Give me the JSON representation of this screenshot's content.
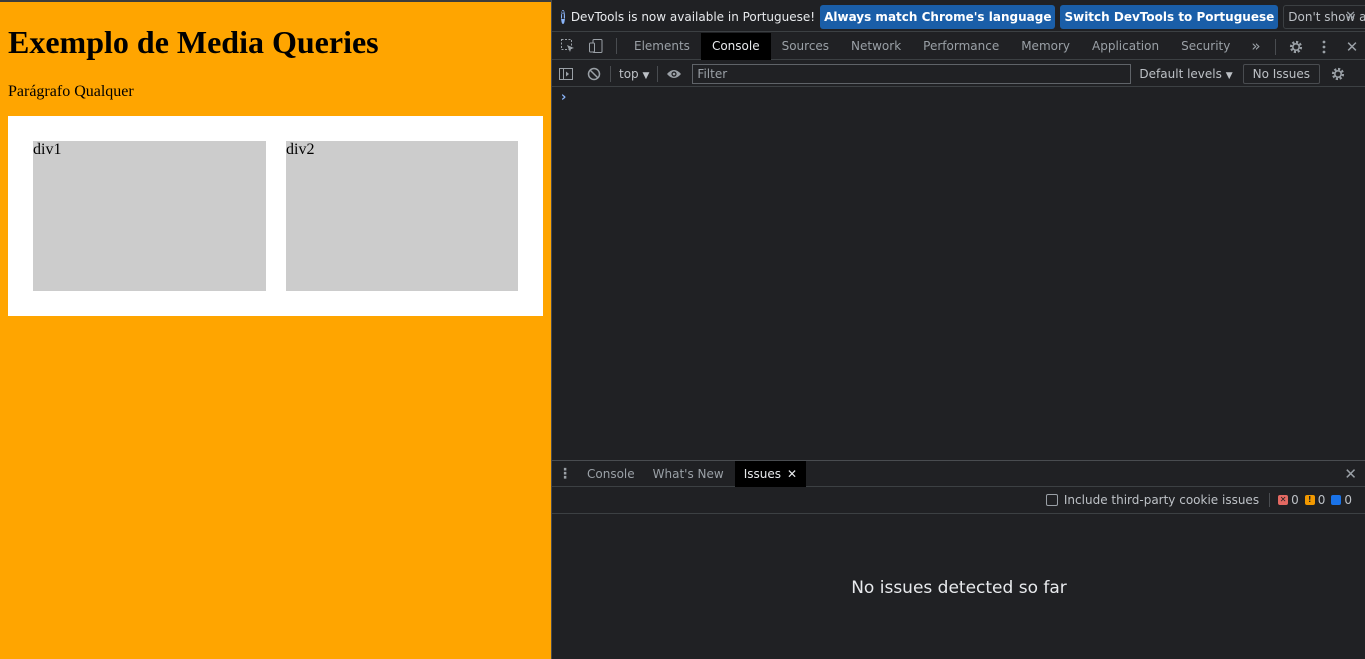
{
  "page": {
    "heading": "Exemplo de Media Queries",
    "paragraph": "Parágrafo Qualquer",
    "boxes": [
      "div1",
      "div2"
    ],
    "colors": {
      "background": "#ffa500",
      "container": "#ffffff",
      "box": "#cccccc"
    }
  },
  "devtools": {
    "infobar": {
      "message": "DevTools is now available in Portuguese!",
      "match_button": "Always match Chrome's language",
      "switch_button": "Switch DevTools to Portuguese",
      "dismiss_button": "Don't show again",
      "icons": {
        "info": "info-icon",
        "close": "close-icon"
      }
    },
    "tabs": [
      "Elements",
      "Console",
      "Sources",
      "Network",
      "Performance",
      "Memory",
      "Application",
      "Security"
    ],
    "active_tab": "Console",
    "toolbar": {
      "context": "top",
      "filter_placeholder": "Filter",
      "levels": "Default levels",
      "issues_button": "No Issues"
    },
    "drawer": {
      "tabs": [
        "Console",
        "What's New",
        "Issues"
      ],
      "active_tab": "Issues",
      "third_party_label": "Include third-party cookie issues",
      "counts": {
        "errors": "0",
        "warnings": "0",
        "info": "0"
      },
      "empty_message": "No issues detected so far"
    },
    "colors": {
      "accent": "#8ab4f8",
      "button_primary": "#1a5ea8",
      "error": "#e46962",
      "warning": "#f29900",
      "info": "#1a73e8"
    }
  }
}
